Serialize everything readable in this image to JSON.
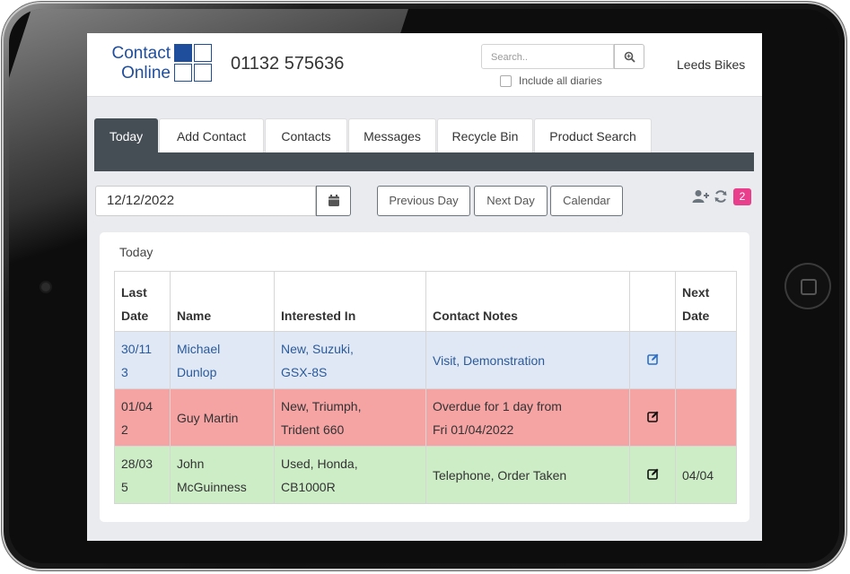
{
  "header": {
    "logo_line1": "Contact",
    "logo_line2": "Online",
    "phone": "01132 575636",
    "search_placeholder": "Search..",
    "include_all_diaries_label": "Include all diaries",
    "organisation": "Leeds Bikes"
  },
  "tabs": [
    {
      "label": "Today",
      "active": true
    },
    {
      "label": "Add Contact",
      "active": false
    },
    {
      "label": "Contacts",
      "active": false
    },
    {
      "label": "Messages",
      "active": false
    },
    {
      "label": "Recycle Bin",
      "active": false
    },
    {
      "label": "Product Search",
      "active": false
    }
  ],
  "toolbar": {
    "date_value": "12/12/2022",
    "previous_day": "Previous Day",
    "next_day": "Next Day",
    "calendar": "Calendar",
    "badge_count": "2"
  },
  "card": {
    "title": "Today",
    "columns": [
      "Last Date",
      "Name",
      "Interested In",
      "Contact Notes",
      "",
      "Next Date"
    ],
    "rows": [
      {
        "last_date_1": "30/11",
        "last_date_2": "3",
        "name_1": "Michael",
        "name_2": "Dunlop",
        "interest_1": "New, Suzuki,",
        "interest_2": "GSX-8S",
        "notes_1": "Visit, Demonstration",
        "notes_2": "",
        "next_date": "",
        "style": "blue"
      },
      {
        "last_date_1": "01/04",
        "last_date_2": "2",
        "name_1": "Guy Martin",
        "name_2": "",
        "interest_1": "New, Triumph,",
        "interest_2": "Trident 660",
        "notes_1": "Overdue for 1 day from",
        "notes_2": "Fri 01/04/2022",
        "next_date": "",
        "style": "red"
      },
      {
        "last_date_1": "28/03",
        "last_date_2": "5",
        "name_1": "John",
        "name_2": "McGuinness",
        "interest_1": "Used, Honda,",
        "interest_2": "CB1000R",
        "notes_1": "Telephone, Order Taken",
        "notes_2": "",
        "next_date": "04/04",
        "style": "green"
      }
    ]
  },
  "colors": {
    "brand": "#1f4e9c",
    "tab_active": "#454d55",
    "badge": "#e83e8c",
    "row_blue": "#e1e8f5",
    "row_red": "#f5a3a3",
    "row_green": "#cdedc7"
  },
  "icons": [
    "search-icon",
    "calendar-icon",
    "add-user-icon",
    "refresh-icon",
    "edit-icon"
  ]
}
